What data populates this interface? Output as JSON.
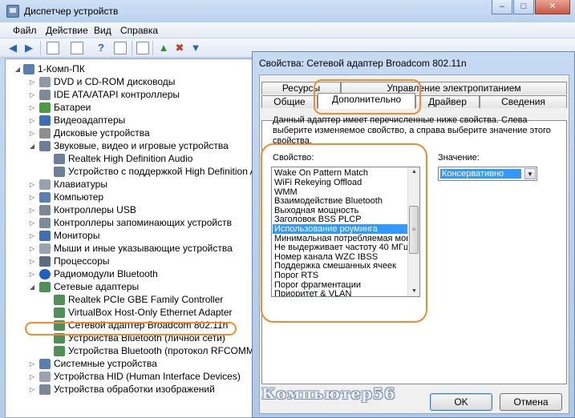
{
  "window": {
    "title": "Диспетчер устройств"
  },
  "menu": [
    "Файл",
    "Действие",
    "Вид",
    "Справка"
  ],
  "tree": {
    "root": "1-Комп-ПК",
    "items": [
      "DVD и CD-ROM дисководы",
      "IDE ATA/ATAPI контроллеры",
      "Батареи",
      "Видеоадаптеры",
      "Дисковые устройства",
      "Звуковые, видео и игровые устройства",
      "Realtek High Definition Audio",
      "Устройство с поддержкой High Definition Audio",
      "Клавиатуры",
      "Компьютер",
      "Контроллеры USB",
      "Контроллеры запоминающих устройств",
      "Мониторы",
      "Мыши и иные указывающие устройства",
      "Процессоры",
      "Радиомодули Bluetooth",
      "Сетевые адаптеры",
      "Realtek PCIe GBE Family Controller",
      "VirtualBox Host-Only Ethernet Adapter",
      "Сетевой адаптер Broadcom 802.11n",
      "Устройства Bluetooth (личной сети)",
      "Устройства Bluetooth (протокол RFCOMM TDI)",
      "Системные устройства",
      "Устройства HID (Human Interface Devices)",
      "Устройства обработки изображений"
    ]
  },
  "dialog": {
    "title": "Свойства: Сетевой адаптер Broadcom 802.11n",
    "tabs_row1": [
      "Ресурсы",
      "Управление электропитанием"
    ],
    "tabs_row2": [
      "Общие",
      "Дополнительно",
      "Драйвер",
      "Сведения"
    ],
    "description": "Данный адаптер имеет перечисленные ниже свойства. Слева выберите изменяемое свойство, а справа выберите значение этого свойства.",
    "property_label": "Свойство:",
    "value_label": "Значение:",
    "properties": [
      "Wake On Pattern Match",
      "WiFi Rekeying Offload",
      "WMM",
      "Взаимодействие Bluetooth",
      "Выходная мощность",
      "Заголовок BSS PLCP",
      "Использование роуминга",
      "Минимальная потребляемая мощно",
      "Не выдерживает частоту 40 МГц",
      "Номер канала WZC IBSS",
      "Поддержка смешанных ячеек",
      "Порог RTS",
      "Порог фрагментации",
      "Приоритет & VLAN"
    ],
    "selected_property": "Использование роуминга",
    "value": "Консервативно",
    "ok": "OK",
    "cancel": "Отмена"
  },
  "watermark": "Компьютер56",
  "colors": {
    "highlight": "#ee8c32",
    "selection": "#3399ff"
  }
}
